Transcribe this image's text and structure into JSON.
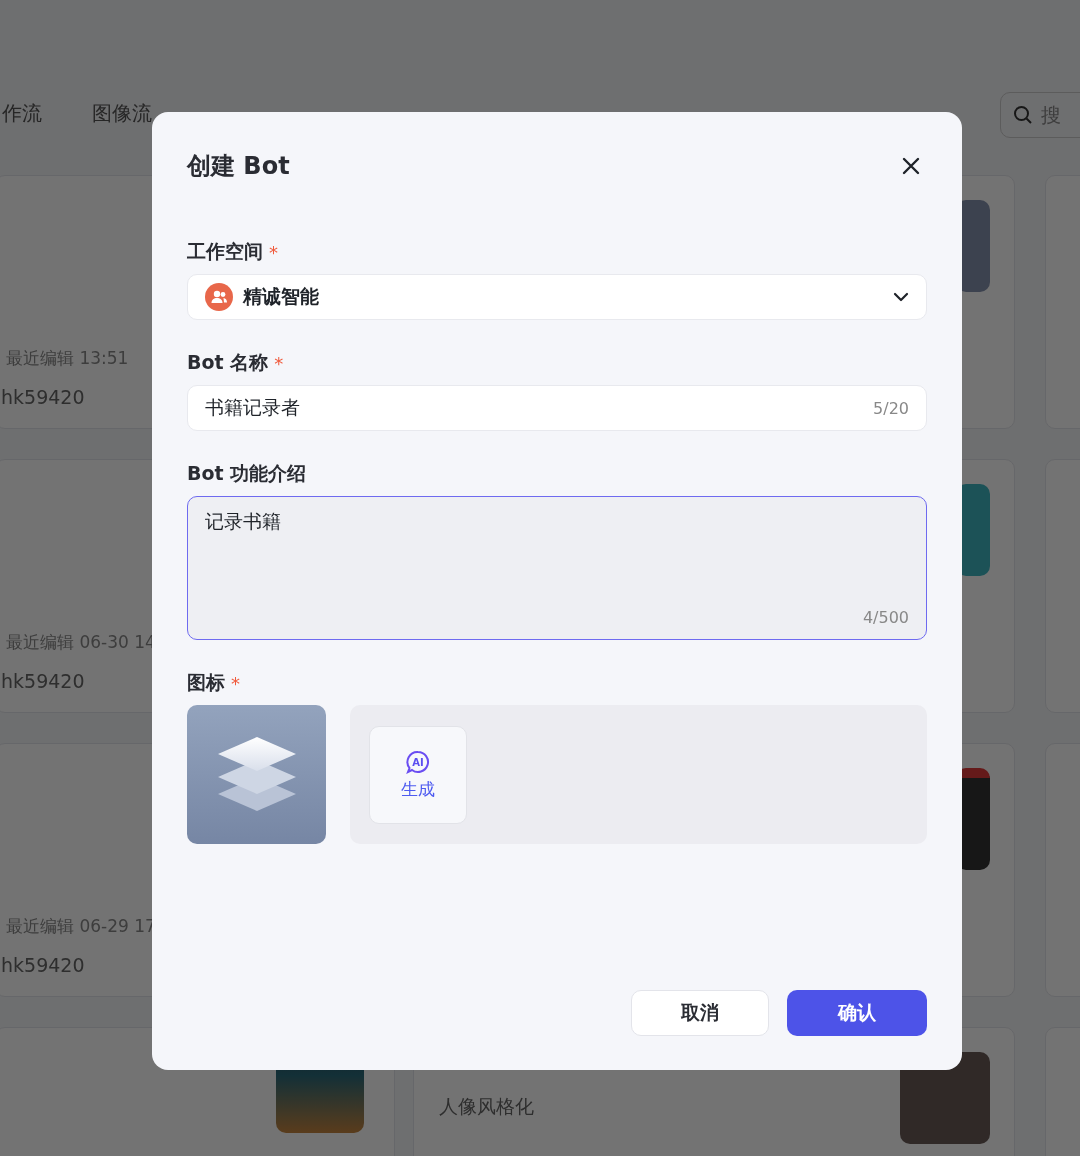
{
  "background": {
    "tabs": [
      {
        "label": "作流"
      },
      {
        "label": "图像流"
      }
    ],
    "search": {
      "placeholder": "搜"
    },
    "cards": [
      {
        "meta": "最近编辑 13:51",
        "owner": "hk59420"
      },
      {
        "meta": "最近编辑 06-30 14",
        "owner": "hk59420"
      },
      {
        "meta": "最近编辑 06-29 17",
        "owner": "hk59420"
      }
    ],
    "bottom_card": {
      "subtitle": "人像风格化"
    }
  },
  "dialog": {
    "title": "创建 Bot",
    "fields": [
      {
        "kind": "select",
        "label": "工作空间",
        "required_mark": "*",
        "value": "精诚智能"
      },
      {
        "kind": "text",
        "label": "Bot 名称",
        "required_mark": "*",
        "value": "书籍记录者",
        "counter": "5/20",
        "focused": false
      },
      {
        "kind": "textarea",
        "label": "Bot 功能介绍",
        "value": "记录书籍",
        "counter": "4/500",
        "focused": true
      }
    ],
    "icon_field": {
      "label": "图标",
      "required_mark": "*",
      "ai_icon_text": "AI",
      "generate_label": "生成"
    },
    "buttons": [
      {
        "label": "取消",
        "kind": "secondary"
      },
      {
        "label": "确认",
        "kind": "primary"
      }
    ]
  }
}
